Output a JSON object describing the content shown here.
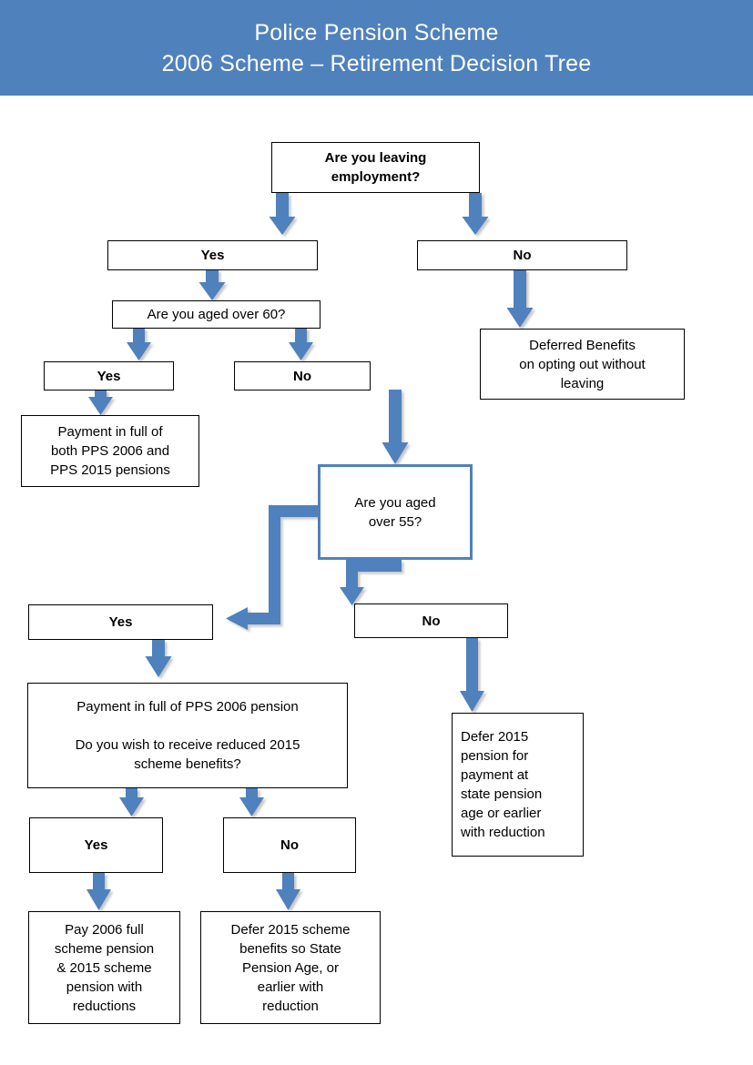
{
  "header": {
    "line1": "Police Pension Scheme",
    "line2": "2006 Scheme – Retirement Decision Tree",
    "background_color": "#4F81BD",
    "text_color": "#FFFFFF"
  },
  "theme": {
    "connector_color": "#4F81BD",
    "node_border_color": "#000000",
    "node_background": "#FFFFFF",
    "decision_55_border_color": "#4F81BD"
  },
  "chart_data": {
    "type": "diagram",
    "title": "2006 Scheme – Retirement Decision Tree",
    "nodes": [
      {
        "id": "q-leaving",
        "label": "Are you leaving\nemployment?",
        "kind": "question",
        "bold": true
      },
      {
        "id": "leaving-yes",
        "label": "Yes",
        "kind": "answer",
        "bold": true
      },
      {
        "id": "leaving-no",
        "label": "No",
        "kind": "answer",
        "bold": true
      },
      {
        "id": "q-over60",
        "label": "Are you aged over 60?",
        "kind": "question",
        "bold": false
      },
      {
        "id": "deferred-opt-out",
        "label": "Deferred Benefits\non opting out without\nleaving",
        "kind": "outcome",
        "bold": false
      },
      {
        "id": "over60-yes",
        "label": "Yes",
        "kind": "answer",
        "bold": true
      },
      {
        "id": "over60-no",
        "label": "No",
        "kind": "answer",
        "bold": true
      },
      {
        "id": "pay-both",
        "label": "Payment in full of\nboth PPS 2006 and\nPPS 2015 pensions",
        "kind": "outcome",
        "bold": false
      },
      {
        "id": "q-over55",
        "label": "Are you aged\nover 55?",
        "kind": "question",
        "bold": false
      },
      {
        "id": "over55-yes",
        "label": "Yes",
        "kind": "answer",
        "bold": true
      },
      {
        "id": "over55-no",
        "label": "No",
        "kind": "answer",
        "bold": true
      },
      {
        "id": "q-reduced-2015",
        "label": "Payment in full of PPS 2006 pension\n\nDo you wish to receive reduced 2015\nscheme benefits?",
        "kind": "question",
        "bold": false
      },
      {
        "id": "defer-2015-spa",
        "label": "Defer 2015\npension for\npayment at\nstate pension\nage or earlier\nwith reduction",
        "kind": "outcome",
        "bold": false
      },
      {
        "id": "reduced-yes",
        "label": "Yes",
        "kind": "answer",
        "bold": true
      },
      {
        "id": "reduced-no",
        "label": "No",
        "kind": "answer",
        "bold": true
      },
      {
        "id": "pay-2006-full",
        "label": "Pay 2006 full\nscheme pension\n& 2015 scheme\npension with\nreductions",
        "kind": "outcome",
        "bold": false
      },
      {
        "id": "defer-2015-spa-2",
        "label": "Defer 2015 scheme\nbenefits so State\nPension Age, or\nearlier with\nreduction",
        "kind": "outcome",
        "bold": false
      }
    ],
    "edges": [
      {
        "from": "q-leaving",
        "to": "leaving-yes"
      },
      {
        "from": "q-leaving",
        "to": "leaving-no"
      },
      {
        "from": "leaving-yes",
        "to": "q-over60"
      },
      {
        "from": "leaving-no",
        "to": "deferred-opt-out"
      },
      {
        "from": "q-over60",
        "to": "over60-yes"
      },
      {
        "from": "q-over60",
        "to": "over60-no"
      },
      {
        "from": "over60-yes",
        "to": "pay-both"
      },
      {
        "from": "over60-no",
        "to": "q-over55"
      },
      {
        "from": "q-over55",
        "to": "over55-yes"
      },
      {
        "from": "q-over55",
        "to": "over55-no"
      },
      {
        "from": "over55-yes",
        "to": "q-reduced-2015"
      },
      {
        "from": "over55-no",
        "to": "defer-2015-spa"
      },
      {
        "from": "q-reduced-2015",
        "to": "reduced-yes"
      },
      {
        "from": "q-reduced-2015",
        "to": "reduced-no"
      },
      {
        "from": "reduced-yes",
        "to": "pay-2006-full"
      },
      {
        "from": "reduced-no",
        "to": "defer-2015-spa-2"
      }
    ]
  }
}
